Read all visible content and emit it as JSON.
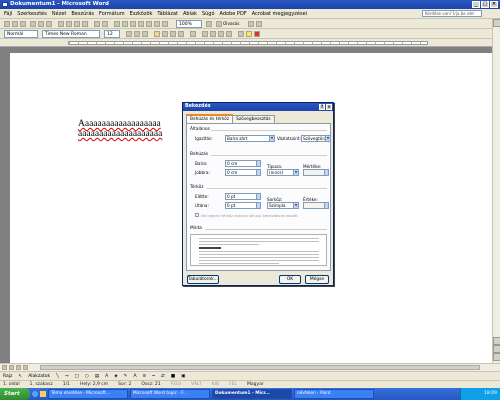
{
  "window": {
    "title": "Dokumentum1 - Microsoft Word"
  },
  "menu": {
    "items": [
      "Fájl",
      "Szerkesztés",
      "Nézet",
      "Beszúrás",
      "Formátum",
      "Eszközök",
      "Táblázat",
      "Ablak",
      "Súgó",
      "Adobe PDF",
      "Acrobat megjegyzései"
    ],
    "help_placeholder": "Kérdése van? Írja be ide!"
  },
  "toolbar": {
    "style": "Normál",
    "font": "Times New Roman",
    "size": "12",
    "zoom": "100%",
    "reading": "Olvasás"
  },
  "document": {
    "lines": [
      "Aaaaaaaaaaaaaaaaaaa",
      "aaaaaaaaaaaaaaaaaaaa"
    ]
  },
  "dialog": {
    "title": "Bekezdés",
    "tabs": [
      "Behúzás és térköz",
      "Szövegbeosztás"
    ],
    "general": {
      "group": "Általános",
      "align_label": "Igazítás:",
      "align_value": "Balra zárt",
      "outline_label": "Vázlatszint:",
      "outline_value": "Szövegtörzs"
    },
    "indent": {
      "group": "Behúzás",
      "left_label": "Balra:",
      "left_value": "0 cm",
      "right_label": "Jobbra:",
      "right_value": "0 cm",
      "special_label": "Típusa:",
      "special_value": "(nincs)",
      "by_label": "Mértéke:"
    },
    "spacing": {
      "group": "Térköz",
      "before_label": "Előtte:",
      "before_value": "0 pt",
      "after_label": "Utána:",
      "after_value": "0 pt",
      "line_label": "Sorköz:",
      "line_value": "Szimpla",
      "at_label": "Értéke:",
      "checkbox_label": "Ne legyen térköz azonos stílusú bekezdések között"
    },
    "preview_label": "Minta",
    "buttons": {
      "tabs": "Tabulátorok...",
      "ok": "OK",
      "cancel": "Mégse"
    }
  },
  "drawbar": {
    "draw": "Rajz",
    "autoshapes": "Alakzatok"
  },
  "status": {
    "page": "1. oldal",
    "section": "1. szakasz",
    "pages": "1/1",
    "position": "Hely: 2,9 cm",
    "row": "Sor: 2",
    "col": "Ossz: 21",
    "modes": [
      "FELV",
      "VÁLT",
      "KIB",
      "FEL"
    ],
    "language": "Magyar"
  },
  "taskbar": {
    "start": "Start",
    "tasks": [
      {
        "label": "Téma elvetése - Microsoft...",
        "active": false
      },
      {
        "label": "Microsoft Word topic - F...",
        "active": false
      },
      {
        "label": "Dokumentum1 - Micr...",
        "active": true
      },
      {
        "label": "névtelen - Paint",
        "active": false
      }
    ],
    "clock": "18:09"
  }
}
